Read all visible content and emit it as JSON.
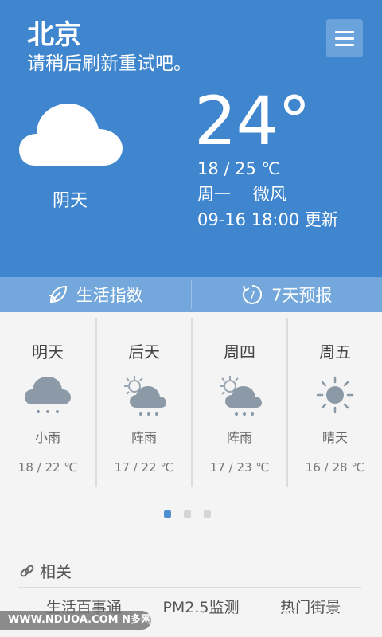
{
  "header": {
    "city": "北京",
    "message": "请稍后刷新重试吧。",
    "menu_icon": "menu-icon"
  },
  "current": {
    "condition": "阴天",
    "temperature": "24°",
    "range": "18 / 25 ℃",
    "weekday": "周一",
    "wind": "微风",
    "updated": "09-16  18:00 更新"
  },
  "tabs": [
    {
      "label": "生活指数",
      "icon": "leaf-icon"
    },
    {
      "label": "7天预报",
      "icon": "seven-day-icon",
      "icon_text": "7"
    }
  ],
  "forecast": [
    {
      "day": "明天",
      "icon": "rain-cloud-icon",
      "desc": "小雨",
      "temp": "18 / 22 ℃"
    },
    {
      "day": "后天",
      "icon": "sun-cloud-rain-icon",
      "desc": "阵雨",
      "temp": "17 / 22 ℃"
    },
    {
      "day": "周四",
      "icon": "sun-cloud-rain-icon",
      "desc": "阵雨",
      "temp": "17 / 23 ℃"
    },
    {
      "day": "周五",
      "icon": "sun-icon",
      "desc": "晴天",
      "temp": "16 / 28 ℃"
    }
  ],
  "pager": {
    "pages": 3,
    "active": 1
  },
  "related": {
    "title": "相关",
    "links": [
      "生活百事通",
      "PM2.5监测",
      "热门街景"
    ]
  },
  "watermark": "WWW.NDUOA.COM N多网",
  "colors": {
    "hero": "#3f86cf",
    "tabbar": "#74a8dc",
    "accent": "#4f8fd1"
  }
}
